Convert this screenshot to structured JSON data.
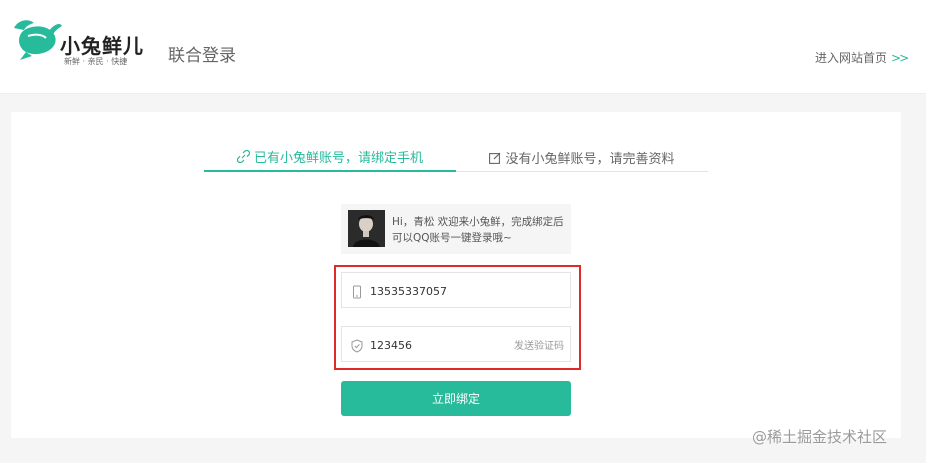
{
  "header": {
    "logo": {
      "name": "小兔鲜儿",
      "slogan": "新鲜 · 亲民 · 快捷",
      "icon": "rabbit-logo-icon",
      "brand_color": "#27ba9b"
    },
    "sub_title": "联合登录",
    "home_link": "进入网站首页",
    "home_link_icon": "double-chevron-right-icon"
  },
  "tabs": [
    {
      "label": "已有小兔鲜账号，请绑定手机",
      "icon": "link-icon",
      "active": true
    },
    {
      "label": "没有小兔鲜账号，请完善资料",
      "icon": "edit-icon",
      "active": false
    }
  ],
  "user_info": {
    "avatar": "avatar",
    "message": "Hi，青松 欢迎来小兔鲜，完成绑定后可以QQ账号一键登录哦~"
  },
  "form": {
    "phone": {
      "value": "13535337057",
      "icon": "phone-icon"
    },
    "code": {
      "value": "123456",
      "icon": "shield-icon",
      "send_label": "发送验证码"
    },
    "submit_label": "立即绑定"
  },
  "colors": {
    "accent": "#27ba9b",
    "highlight": "#e02a2a"
  },
  "watermark": "@稀土掘金技术社区"
}
